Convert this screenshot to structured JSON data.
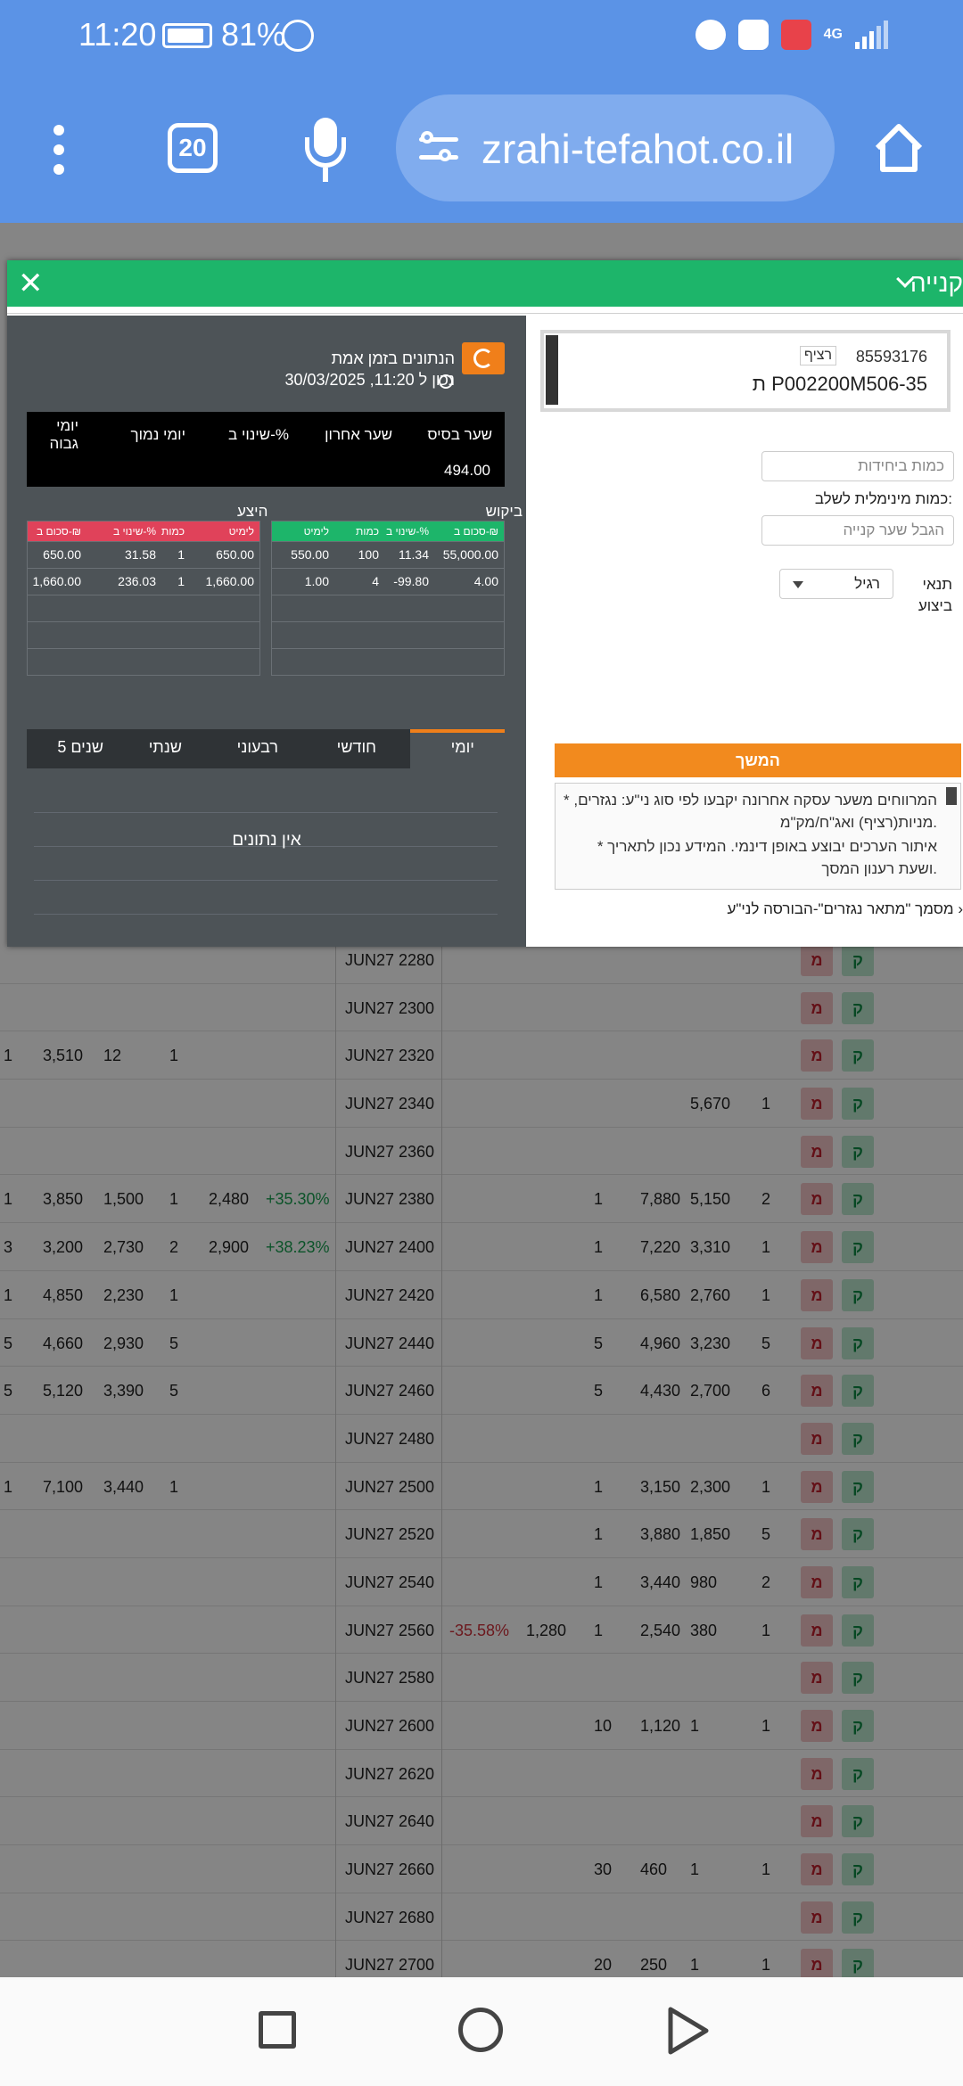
{
  "status": {
    "time": "11:20",
    "battery": "81%",
    "network": "4G"
  },
  "browser": {
    "tab_count": "20",
    "url": "zrahi-tefahot.co.il"
  },
  "table_rows": [
    {
      "strike": "JUN27 2280",
      "cells": [],
      "kq": []
    },
    {
      "strike": "JUN27 2300",
      "cells": [],
      "kq": []
    },
    {
      "strike": "JUN27 2320",
      "cells": [
        "1",
        "3,510",
        "12",
        "1",
        "",
        ""
      ],
      "kq": []
    },
    {
      "strike": "JUN27 2340",
      "cells": [],
      "kq": [
        "",
        "",
        "5,670",
        "1"
      ]
    },
    {
      "strike": "JUN27 2360",
      "cells": [],
      "kq": []
    },
    {
      "strike": "JUN27 2380",
      "cells": [
        "1",
        "3,850",
        "1,500",
        "1",
        "2,480",
        "+35.30%"
      ],
      "kq": [
        "1",
        "7,880",
        "5,150",
        "2"
      ]
    },
    {
      "strike": "JUN27 2400",
      "cells": [
        "3",
        "3,200",
        "2,730",
        "2",
        "2,900",
        "+38.23%"
      ],
      "kq": [
        "1",
        "7,220",
        "3,310",
        "1"
      ]
    },
    {
      "strike": "JUN27 2420",
      "cells": [
        "1",
        "4,850",
        "2,230",
        "1",
        "",
        ""
      ],
      "kq": [
        "1",
        "6,580",
        "2,760",
        "1"
      ]
    },
    {
      "strike": "JUN27 2440",
      "cells": [
        "5",
        "4,660",
        "2,930",
        "5",
        "",
        ""
      ],
      "kq": [
        "5",
        "4,960",
        "3,230",
        "5"
      ]
    },
    {
      "strike": "JUN27 2460",
      "cells": [
        "5",
        "5,120",
        "3,390",
        "5",
        "",
        ""
      ],
      "kq": [
        "5",
        "4,430",
        "2,700",
        "6"
      ]
    },
    {
      "strike": "JUN27 2480",
      "cells": [],
      "kq": []
    },
    {
      "strike": "JUN27 2500",
      "cells": [
        "1",
        "7,100",
        "3,440",
        "1",
        "",
        ""
      ],
      "kq": [
        "1",
        "3,150",
        "2,300",
        "1"
      ]
    },
    {
      "strike": "JUN27 2520",
      "cells": [],
      "kq": [
        "1",
        "3,880",
        "1,850",
        "5"
      ]
    },
    {
      "strike": "JUN27 2540",
      "cells": [],
      "kq": [
        "1",
        "3,440",
        "980",
        "2"
      ]
    },
    {
      "strike": "JUN27 2560",
      "cells": [],
      "pct": "-35.58%",
      "last": "1,280",
      "kq": [
        "1",
        "2,540",
        "380",
        "1"
      ]
    },
    {
      "strike": "JUN27 2580",
      "cells": [],
      "kq": []
    },
    {
      "strike": "JUN27 2600",
      "cells": [],
      "kq": [
        "10",
        "1,120",
        "1",
        "1"
      ]
    },
    {
      "strike": "JUN27 2620",
      "cells": [],
      "kq": []
    },
    {
      "strike": "JUN27 2640",
      "cells": [],
      "kq": []
    },
    {
      "strike": "JUN27 2660",
      "cells": [],
      "kq": [
        "30",
        "460",
        "1",
        "1"
      ]
    },
    {
      "strike": "JUN27 2680",
      "cells": [],
      "kq": []
    },
    {
      "strike": "JUN27 2700",
      "cells": [],
      "kq": [
        "20",
        "250",
        "1",
        "1"
      ]
    }
  ],
  "row_buttons": {
    "sell": "מ",
    "buy": "ק"
  },
  "modal": {
    "title": "קנייה",
    "close": "✕",
    "realtime": {
      "title": "הנתונים בזמן אמת",
      "time": "נכון ל 11:20, 30/03/2025"
    },
    "quote": {
      "headers": [
        "שער בסיס",
        "שער אחרון",
        "שינוי ב-%",
        "יומי נמוך",
        "יומי גבוה"
      ],
      "base_value": "494.00"
    },
    "bid": {
      "label": "ביקוש",
      "headers": [
        "סכום ב-₪",
        "שינוי ב-%",
        "כמות",
        "לימיט"
      ],
      "rows": [
        [
          "55,000.00",
          "11.34",
          "100",
          "550.00"
        ],
        [
          "4.00",
          "-99.80",
          "4",
          "1.00"
        ]
      ]
    },
    "ask": {
      "label": "היצע",
      "headers": [
        "לימיט",
        "כמות",
        "שינוי ב-%",
        "סכום ב-₪"
      ],
      "rows": [
        [
          "650.00",
          "1",
          "31.58",
          "650.00"
        ],
        [
          "1,660.00",
          "1",
          "236.03",
          "1,660.00"
        ]
      ]
    },
    "periods": [
      "יומי",
      "חודשי",
      "רבעוני",
      "שנתי",
      "5 שנים"
    ],
    "no_data": "אין נתונים",
    "security": {
      "number": "85593176",
      "tag": "רציף",
      "name": "ת P002200M506-35"
    },
    "qty_placeholder": "כמות ביחידות",
    "min_qty_label": "כמות מינימלית לשלב:",
    "limit_placeholder": "הגבל שער קנייה",
    "terms_label": "תנאי ביצוע",
    "terms_value": "רגיל",
    "continue": "המשך",
    "notes": [
      "* המרווחים משער עסקה אחרונה יקבעו לפי סוג ני\"ע: נגזרים, מניות(רציף) ואג\"ח/מק\"מ.",
      "* איתור הערכים יבוצע באופן דינמי. המידע נכון לתאריך ושעת רענון המסך."
    ],
    "doc_link": "מסמך \"מתאר נגזרים\"-הבורסה לני\"ע ›"
  }
}
